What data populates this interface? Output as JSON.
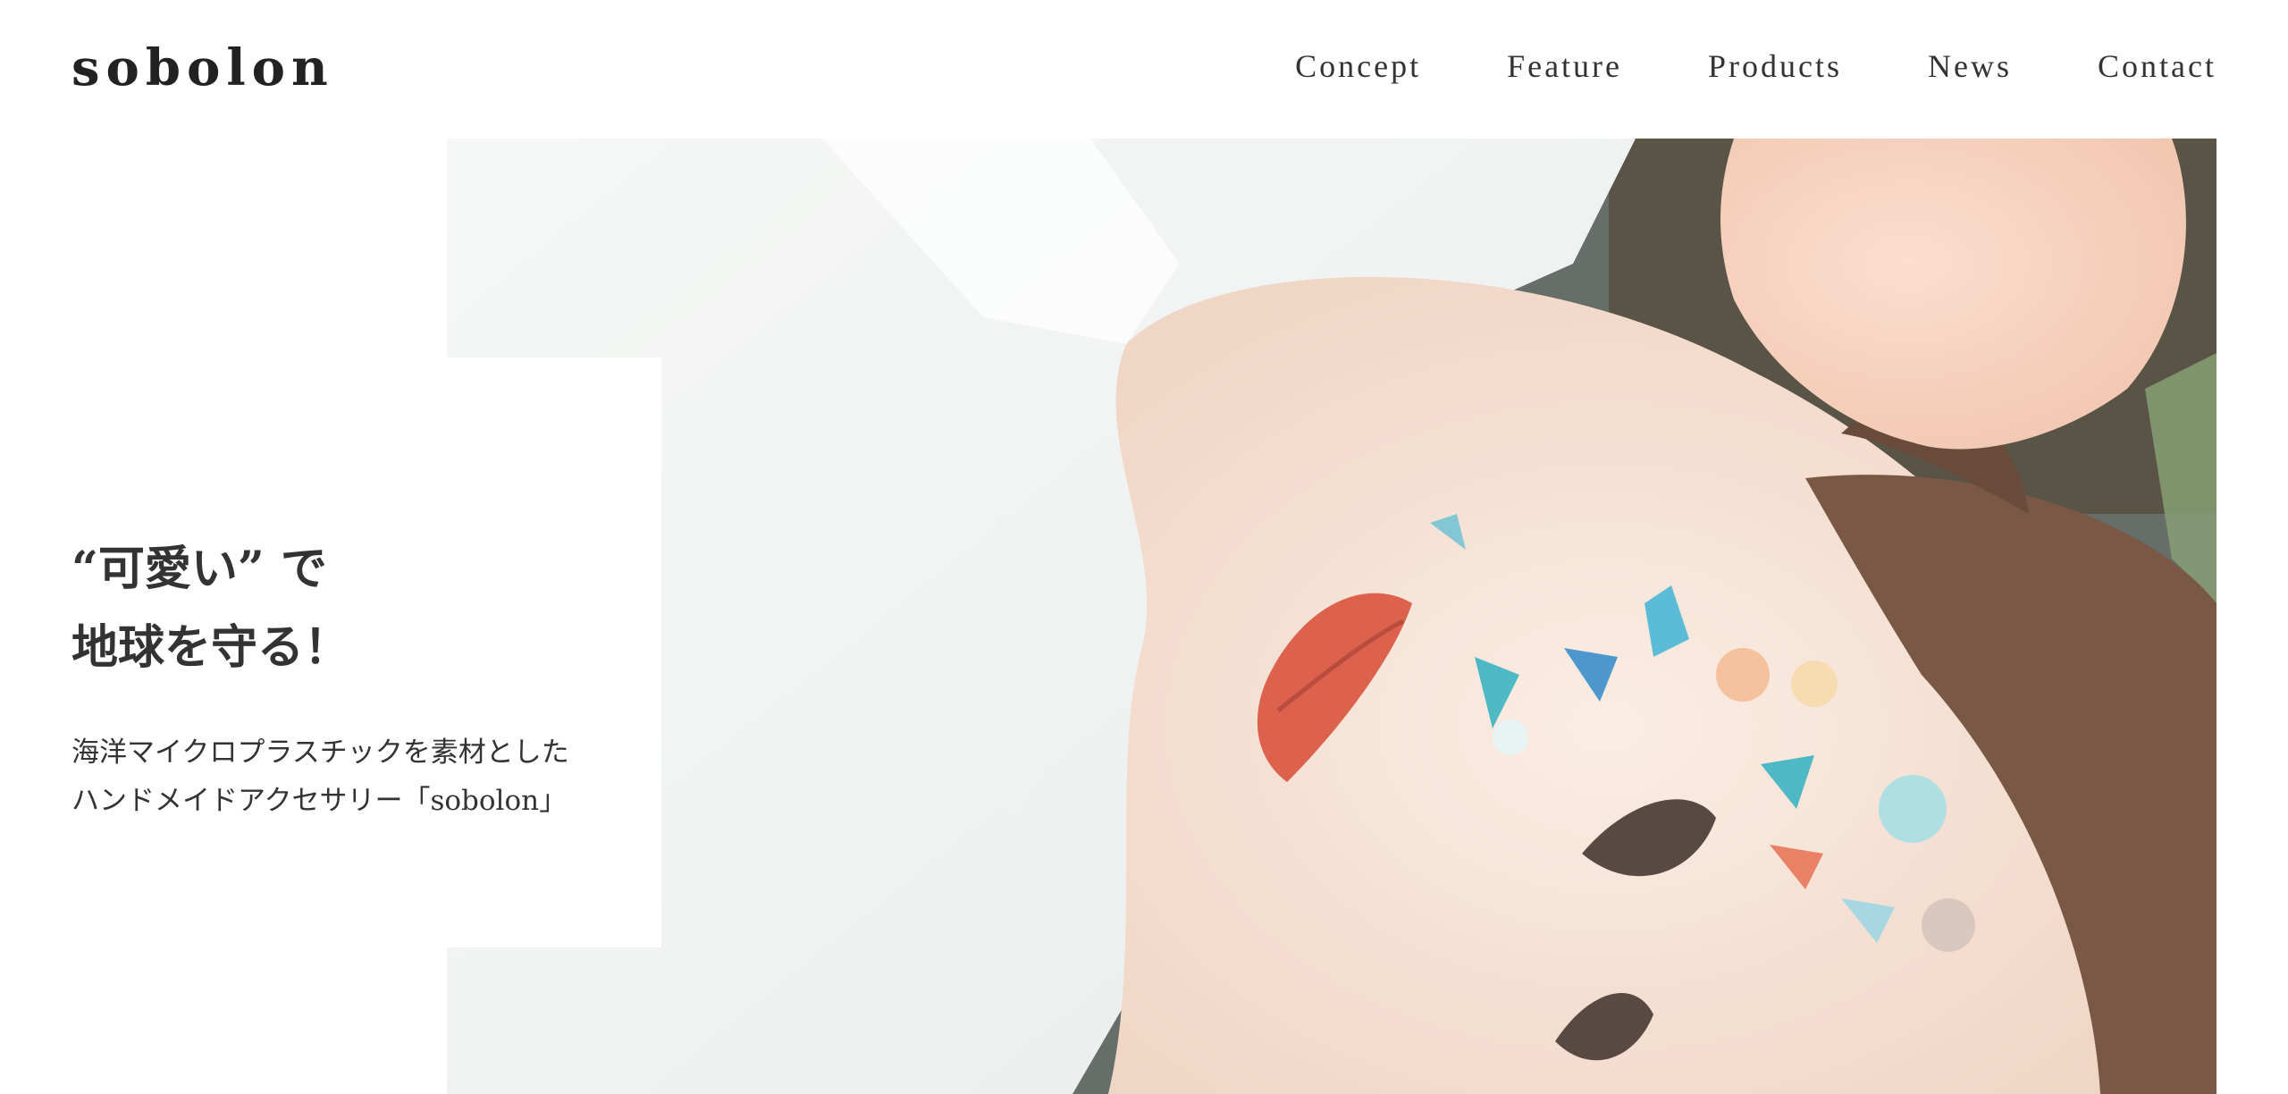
{
  "header": {
    "logo": "sobolon",
    "nav": [
      {
        "label": "Concept"
      },
      {
        "label": "Feature"
      },
      {
        "label": "Products"
      },
      {
        "label": "News"
      },
      {
        "label": "Contact"
      }
    ]
  },
  "hero": {
    "headline": [
      "“可愛い” で",
      "地球を守る！"
    ],
    "description": [
      "海洋マイクロプラスチックを素材とした",
      "ハンドメイドアクセサリー「sobolon」"
    ]
  },
  "colors": {
    "background": "#ffffff",
    "text": "#333333",
    "shirt": "#f3f5f4",
    "skin": "#f6e2d3",
    "hair": "#6e4a36",
    "lips": "#d9553e",
    "accent_teal": "#3fb3c1",
    "accent_blue": "#3d8fc9"
  }
}
